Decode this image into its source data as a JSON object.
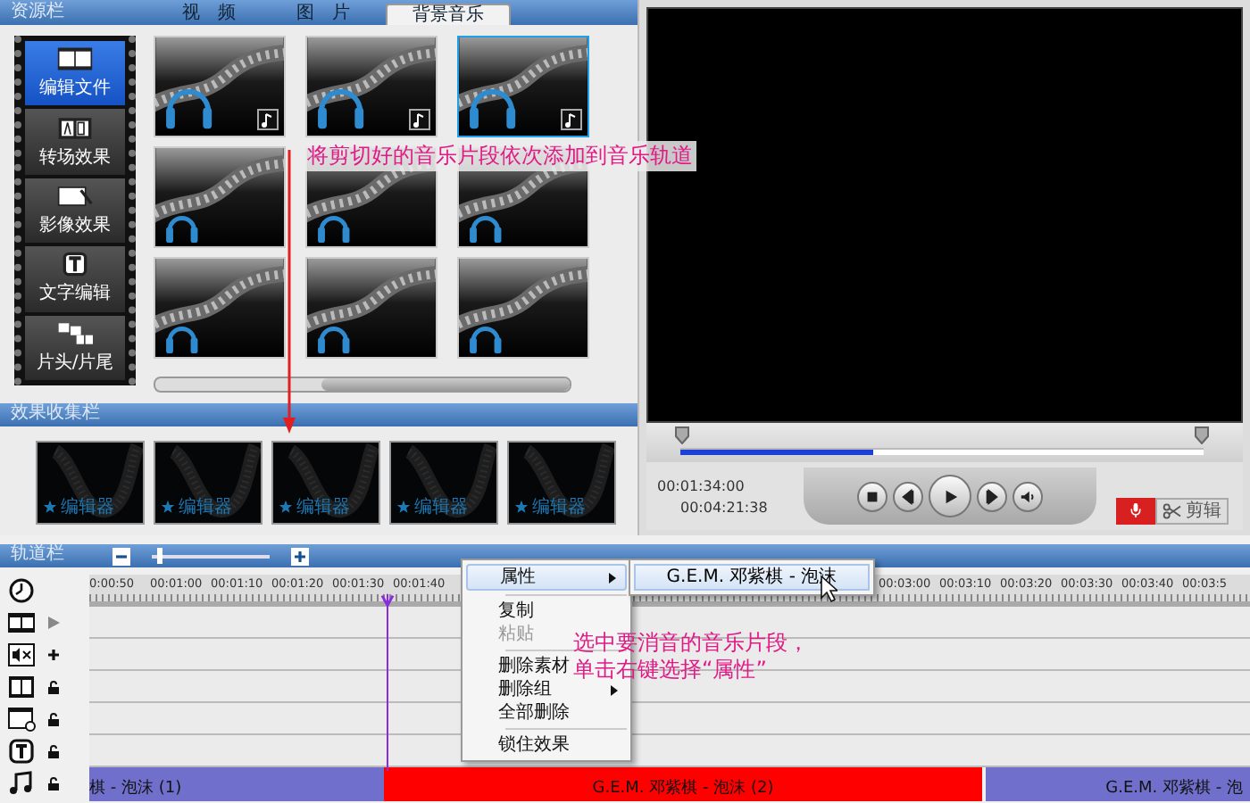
{
  "resource_panel": {
    "title": "资源栏",
    "tabs": [
      {
        "label": "视　频",
        "selected": false
      },
      {
        "label": "图　片",
        "selected": false
      },
      {
        "label": "背景音乐",
        "selected": true
      }
    ],
    "categories": [
      {
        "label": "编辑文件",
        "selected": true
      },
      {
        "label": "转场效果",
        "selected": false
      },
      {
        "label": "影像效果",
        "selected": false
      },
      {
        "label": "文字编辑",
        "selected": false
      },
      {
        "label": "片头/片尾",
        "selected": false
      }
    ],
    "music_items": [
      {
        "selected": false,
        "note_badge": true
      },
      {
        "selected": false,
        "note_badge": true
      },
      {
        "selected": true,
        "note_badge": true
      },
      {
        "selected": false,
        "note_badge": false
      },
      {
        "selected": false,
        "note_badge": false
      },
      {
        "selected": false,
        "note_badge": false
      },
      {
        "selected": false,
        "note_badge": false
      },
      {
        "selected": false,
        "note_badge": false
      },
      {
        "selected": false,
        "note_badge": false
      }
    ],
    "annotation": "将剪切好的音乐片段依次添加到音乐轨道"
  },
  "effects_panel": {
    "title": "效果收集栏",
    "items": [
      {
        "label": "编辑器"
      },
      {
        "label": "编辑器"
      },
      {
        "label": "编辑器"
      },
      {
        "label": "编辑器"
      },
      {
        "label": "编辑器"
      }
    ]
  },
  "player": {
    "progress": {
      "level": 0.37
    },
    "time_current": "00:01:34:00",
    "time_total": "00:04:21:38",
    "edit_button": "剪辑"
  },
  "timeline": {
    "title": "轨道栏",
    "zoom": {
      "level": 0.04
    },
    "ruler_left": [
      "0:00:50",
      "00:01:00",
      "00:01:10",
      "00:01:20",
      "00:01:30",
      "00:01:40"
    ],
    "ruler_right": [
      "00:03:00",
      "00:03:10",
      "00:03:20",
      "00:03:30",
      "00:03:40",
      "00:03:5"
    ],
    "clips": [
      {
        "label": "棋 - 泡沫 (1)",
        "selected": false
      },
      {
        "label": "G.E.M. 邓紫棋 - 泡沫 (2)",
        "selected": true
      },
      {
        "label": "G.E.M. 邓紫棋 - 泡",
        "selected": false
      }
    ],
    "annotation": [
      "选中要消音的音乐片段，",
      "单击右键选择“属性”"
    ]
  },
  "context_menu": {
    "items": [
      {
        "label": "属性",
        "submenu": true,
        "disabled": false,
        "selected": true,
        "separator_after": true
      },
      {
        "label": "复制",
        "submenu": false,
        "disabled": false,
        "selected": false,
        "separator_after": false
      },
      {
        "label": "粘贴",
        "submenu": false,
        "disabled": true,
        "selected": false,
        "separator_after": true
      },
      {
        "label": "删除素材",
        "submenu": false,
        "disabled": false,
        "selected": false,
        "separator_after": false
      },
      {
        "label": "删除组",
        "submenu": true,
        "disabled": false,
        "selected": false,
        "separator_after": false
      },
      {
        "label": "全部删除",
        "submenu": false,
        "disabled": false,
        "selected": false,
        "separator_after": true
      },
      {
        "label": "锁住效果",
        "submenu": false,
        "disabled": false,
        "selected": false,
        "separator_after": false
      }
    ],
    "submenu": {
      "label": "G.E.M. 邓紫棋 - 泡沫"
    }
  }
}
